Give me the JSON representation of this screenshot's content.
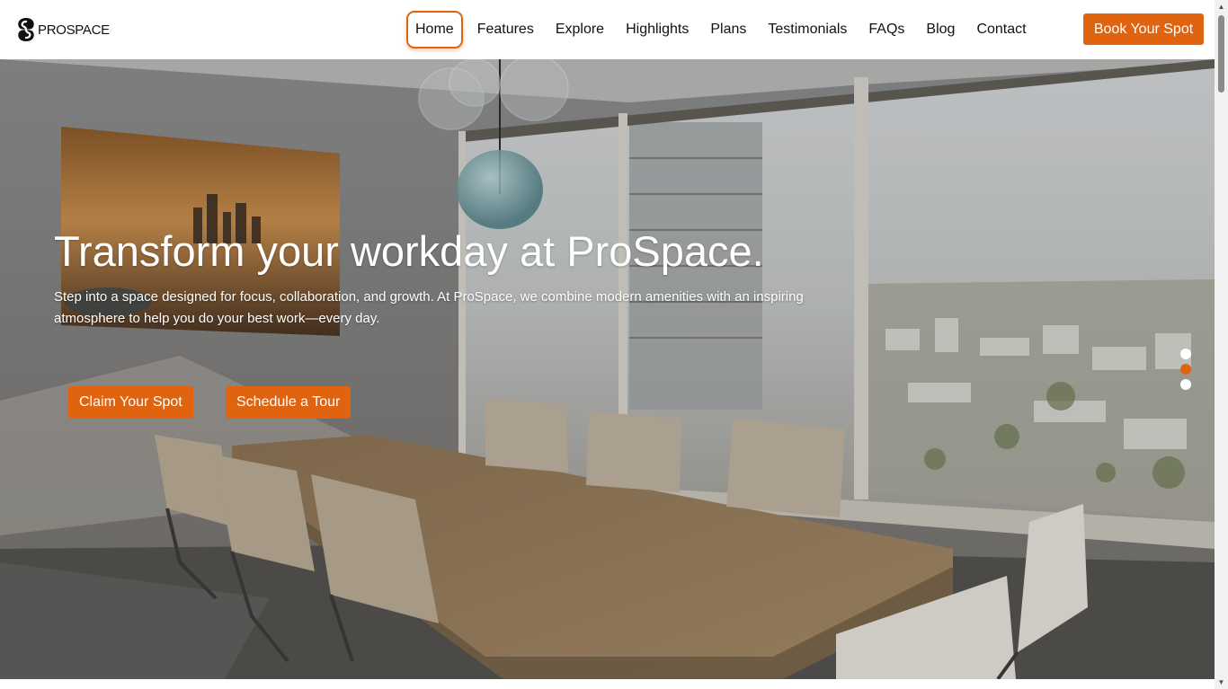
{
  "brand": {
    "name": "PROSPACE",
    "logo_icon": "prospace-logo-icon"
  },
  "nav": {
    "items": [
      {
        "label": "Home",
        "active": true
      },
      {
        "label": "Features"
      },
      {
        "label": "Explore"
      },
      {
        "label": "Highlights"
      },
      {
        "label": "Plans"
      },
      {
        "label": "Testimonials"
      },
      {
        "label": "FAQs"
      },
      {
        "label": "Blog"
      },
      {
        "label": "Contact"
      }
    ],
    "cta_label": "Book Your Spot"
  },
  "hero": {
    "title": "Transform your workday at ProSpace.",
    "description": "Step into a space designed for focus, collaboration, and growth. At ProSpace, we combine modern amenities with an inspiring atmosphere to help you do your best work—every day.",
    "buttons": {
      "claim": "Claim Your Spot",
      "tour": "Schedule a Tour"
    },
    "slider": {
      "count": 3,
      "active_index": 2
    }
  },
  "colors": {
    "accent": "#e0640f",
    "text": "#111111",
    "header_bg": "#ffffff"
  }
}
